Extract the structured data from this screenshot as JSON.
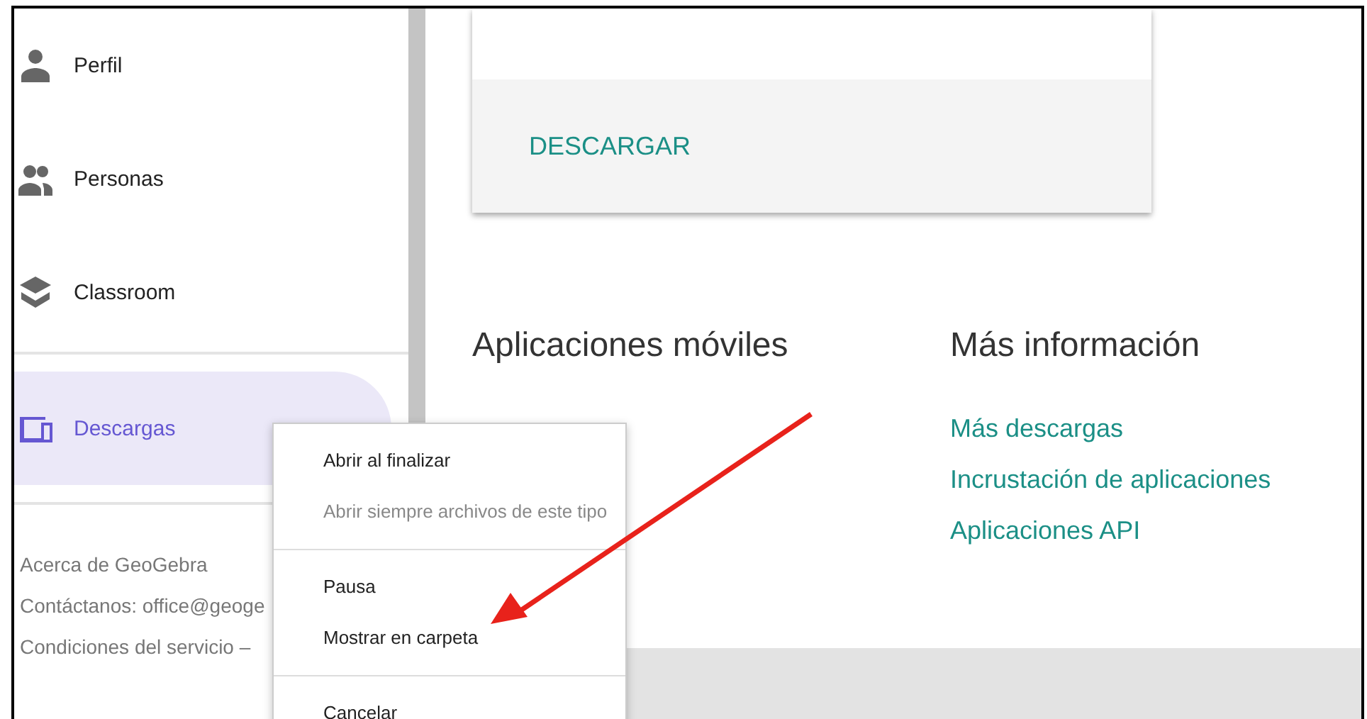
{
  "sidebar": {
    "items": [
      {
        "label": "Perfil",
        "selected": false
      },
      {
        "label": "Personas",
        "selected": false
      },
      {
        "label": "Classroom",
        "selected": false
      },
      {
        "label": "Descargas",
        "selected": true
      }
    ],
    "footer_links": [
      "Acerca de GeoGebra",
      "Contáctanos: office@geoge",
      "Condiciones del servicio  –"
    ]
  },
  "card": {
    "button": "DESCARGAR"
  },
  "sections": [
    {
      "title": "Aplicaciones móviles"
    },
    {
      "title": "Más información",
      "links": [
        "Más descargas",
        "Incrustación de aplicaciones",
        "Aplicaciones API"
      ]
    }
  ],
  "context_menu": {
    "groups": [
      [
        {
          "label": "Abrir al finalizar",
          "disabled": false
        },
        {
          "label": "Abrir siempre archivos de este tipo",
          "disabled": true
        }
      ],
      [
        {
          "label": "Pausa",
          "disabled": false
        },
        {
          "label": "Mostrar en carpeta",
          "disabled": false
        }
      ],
      [
        {
          "label": "Cancelar",
          "disabled": false
        }
      ]
    ]
  }
}
